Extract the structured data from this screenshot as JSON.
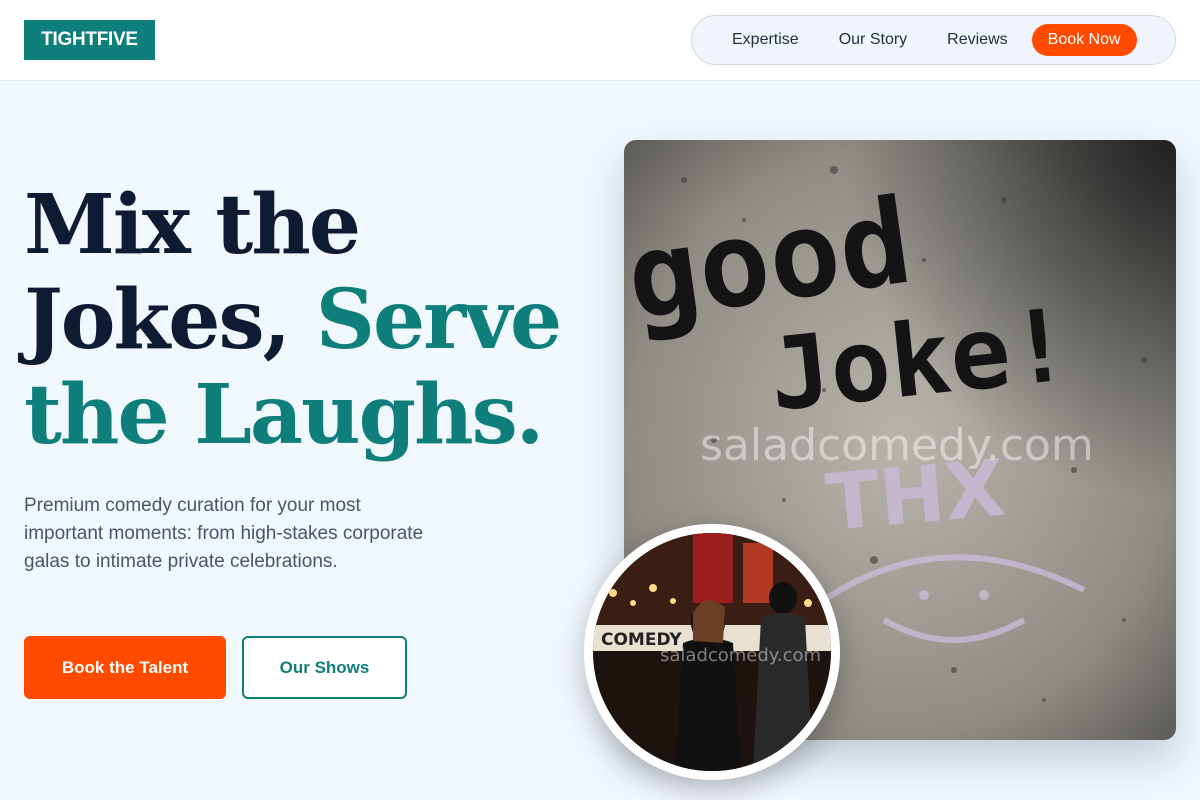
{
  "brand": {
    "logo": "TIGHTFIVE",
    "accent": "#0f7f7c",
    "cta_color": "#ff4a00"
  },
  "nav": {
    "items": [
      {
        "label": "Expertise"
      },
      {
        "label": "Our Story"
      },
      {
        "label": "Reviews"
      }
    ],
    "cta": "Book Now"
  },
  "hero": {
    "title_line1": "Mix the",
    "title_line2": "Jokes,",
    "title_accent": "Serve the Laughs.",
    "subtitle": "Premium comedy curation for your most important moments: from high-stakes corporate galas to intimate private celebrations.",
    "primary_button": "Book the Talent",
    "secondary_button": "Our Shows"
  },
  "images": {
    "main_photo": {
      "graffiti": [
        "good",
        "Joke!",
        "THX"
      ],
      "watermark": "saladcomedy.com"
    },
    "circle_photo": {
      "sign": "COMEDY",
      "watermark": "saladcomedy.com"
    }
  }
}
